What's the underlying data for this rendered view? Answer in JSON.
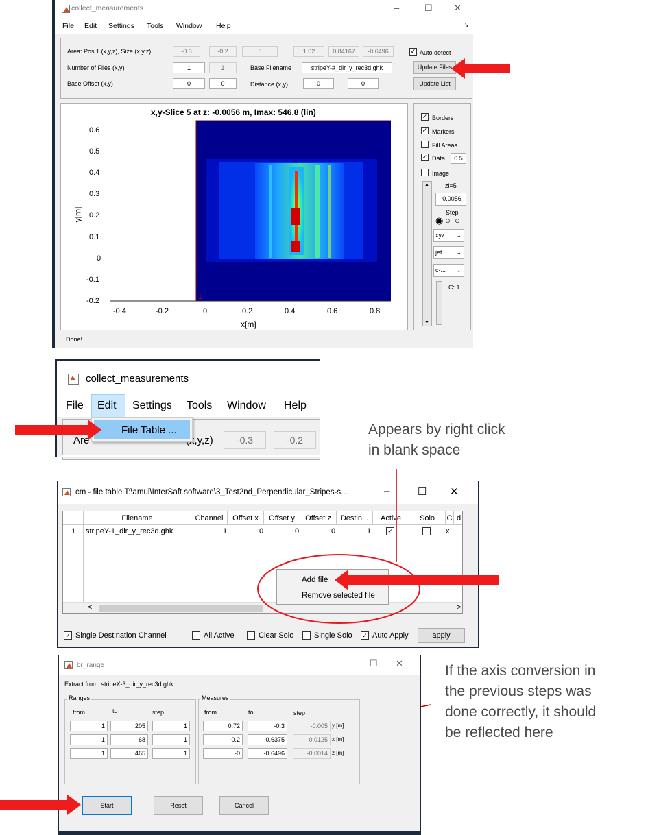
{
  "window1": {
    "title": "collect_measurements",
    "menus": [
      "File",
      "Edit",
      "Settings",
      "Tools",
      "Window",
      "Help"
    ],
    "area_label": "Area: Pos 1 (x,y,z), Size (x,y,z)",
    "area_values": [
      "-0.3",
      "-0.2",
      "0",
      "1.02",
      "0.84167",
      "-0.6496"
    ],
    "num_files_label": "Number of Files (x,y)",
    "num_files_values": [
      "1",
      "1"
    ],
    "base_filename_label": "Base Filename",
    "base_filename_value": "stripeY-#_dir_y_rec3d.ghk",
    "base_offset_label": "Base Offset (x,y)",
    "base_offset_values": [
      "0",
      "0"
    ],
    "distance_label": "Distance (x,y)",
    "distance_values": [
      "0",
      "0"
    ],
    "auto_detect_label": "Auto detect",
    "update_files_label": "Update Files",
    "update_list_label": "Update List",
    "plot_title": "x,y-Slice 5 at z: -0.0056 m, Imax: 546.8 (lin)",
    "x_axis_label": "x[m]",
    "y_axis_label": "y[m]",
    "x_ticks": [
      "-0.4",
      "-0.2",
      "0",
      "0.2",
      "0.4",
      "0.6",
      "0.8"
    ],
    "y_ticks": [
      "0.6",
      "0.5",
      "0.4",
      "0.3",
      "0.2",
      "0.1",
      "0",
      "-0.1",
      "-0.2"
    ],
    "corner_marker": "1",
    "panel": {
      "borders": "Borders",
      "markers": "Markers",
      "fill_areas": "Fill Areas",
      "data": "Data",
      "data_value": "0.5",
      "image": "Image",
      "zi": "zi=5",
      "z_value": "-0.0056",
      "step": "Step",
      "select1": "xyz",
      "select2": "jet",
      "select3": "c-...",
      "channel": "C: 1"
    },
    "status": "Done!"
  },
  "menu_zoom": {
    "title": "collect_measurements",
    "menus": [
      "File",
      "Edit",
      "Settings",
      "Tools",
      "Window",
      "Help"
    ],
    "dropdown_item": "File Table ...",
    "partial_label_a": "Are",
    "partial_label_b": "(x,y,z)",
    "partial_values": [
      "-0.3",
      "-0.2"
    ]
  },
  "note1": [
    "Appears by right click",
    "in blank space"
  ],
  "window2": {
    "title": "cm - file table T:\\amul\\InterSaft software\\3_Test2nd_Perpendicular_Stripes-s...",
    "headers": [
      "Filename",
      "Channel",
      "Offset x",
      "Offset y",
      "Offset z",
      "Destin...",
      "Active",
      "Solo",
      "C",
      "d"
    ],
    "row": {
      "index": "1",
      "filename": "stripeY-1_dir_y_rec3d.ghk",
      "channel": "1",
      "offset_x": "0",
      "offset_y": "0",
      "offset_z": "0",
      "destination": "1",
      "c": "x"
    },
    "context_menu": [
      "Add file",
      "Remove selected file"
    ],
    "single_destination": "Single Destination Channel",
    "all_active": "All Active",
    "clear_solo": "Clear Solo",
    "single_solo": "Single Solo",
    "auto_apply": "Auto Apply",
    "apply": "apply"
  },
  "window3": {
    "title": "br_range",
    "extract_from": "Extract from: stripeX-3_dir_y_rec3d.ghk",
    "ranges_title": "Ranges",
    "measures_title": "Measures",
    "col_from": "from",
    "col_to": "to",
    "col_step": "step",
    "ranges": [
      [
        "1",
        "205",
        "1"
      ],
      [
        "1",
        "68",
        "1"
      ],
      [
        "1",
        "465",
        "1"
      ]
    ],
    "measures": [
      [
        "0.72",
        "-0.3",
        "-0.005"
      ],
      [
        "-0.2",
        "0.6375",
        "0.0125"
      ],
      [
        "-0",
        "-0.6496",
        "-0.0014"
      ]
    ],
    "units": [
      "y [m]",
      "x [m]",
      "z [m]"
    ],
    "start": "Start",
    "reset": "Reset",
    "cancel": "Cancel"
  },
  "note2": [
    "If the axis conversion in",
    "the previous steps was",
    "done correctly, it should",
    "be reflected here"
  ]
}
